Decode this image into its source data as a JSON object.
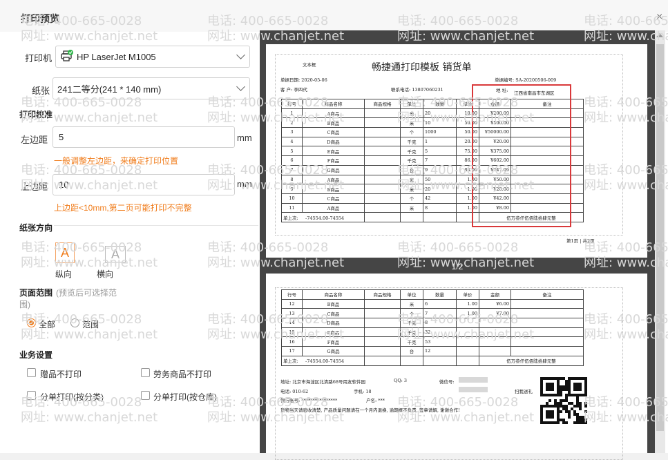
{
  "dialog": {
    "title": "打印预览",
    "close": "×"
  },
  "settings": {
    "printer_label": "打印机",
    "printer_value": "HP LaserJet M1005",
    "paper_label": "纸张",
    "paper_value": "241二等分(241 * 140 mm)",
    "calibration_title": "打印校准",
    "left_margin_label": "左边距",
    "left_margin_value": "5",
    "left_margin_unit": "mm",
    "left_hint": "一般调整左边距，来确定打印位置",
    "top_margin_label": "上边距",
    "top_margin_value": "10",
    "top_margin_unit": "mm",
    "top_hint": "上边距<10mm,第二页可能打印不完整",
    "orientation_title": "纸张方向",
    "portrait_glyph": "A",
    "portrait_label": "纵向",
    "landscape_glyph": "A",
    "landscape_label": "横向",
    "range_title": "页面范围",
    "range_note": "(预览后可选择范",
    "range_note2": "围)",
    "range_all": "全部",
    "range_custom": "范围",
    "business_title": "业务设置",
    "opt1": "赠品不打印",
    "opt2": "劳务商品不打印",
    "opt3": "分单打印(按分类)",
    "opt4": "分单打印(按仓库)"
  },
  "watermark": {
    "phone": "电话: 400-665-0028",
    "site": "网址: www.chanjet.net"
  },
  "preview": {
    "page_indicator": "1/2",
    "doc_label": "文本框",
    "doc_title": "畅捷通打印模板 销货单",
    "date": "单据日期: 2020-05-06",
    "doc_no": "单据编号: SA-20200506-009",
    "customer": "客    户: 李四代",
    "contact": "联系电话: 13807060231",
    "address": "地  址:",
    "address_value": "江西省南昌市东湖区",
    "headers": [
      "行号",
      "商品名称",
      "商品规格",
      "单位",
      "数量",
      "单价",
      "金额",
      "备注"
    ],
    "rows1": [
      [
        "1",
        "A商品",
        "",
        "米",
        "20",
        "10.00",
        "¥200.00",
        ""
      ],
      [
        "2",
        "B商品",
        "",
        "米",
        "10",
        "50.00",
        "¥500.00",
        ""
      ],
      [
        "3",
        "C商品",
        "",
        "个",
        "1000",
        "50.00",
        "¥50000.00",
        ""
      ],
      [
        "4",
        "D商品",
        "",
        "千克",
        "1",
        "20.00",
        "¥20.00",
        ""
      ],
      [
        "5",
        "E商品",
        "",
        "千克",
        "5",
        "75.00",
        "¥375.00",
        ""
      ],
      [
        "6",
        "F商品",
        "",
        "千克",
        "7",
        "86.00",
        "¥602.00",
        ""
      ],
      [
        "7",
        "G商品",
        "",
        "台",
        "9",
        "83.00",
        "¥747.00",
        ""
      ],
      [
        "8",
        "A商品",
        "",
        "米",
        "50",
        "1.00",
        "¥50.00",
        ""
      ],
      [
        "9",
        "B商品",
        "",
        "米",
        "20",
        "1.00",
        "¥20.00",
        ""
      ],
      [
        "10",
        "C商品",
        "",
        "个",
        "42",
        "1.00",
        "¥42.00",
        ""
      ],
      [
        "11",
        "A商品",
        "",
        "米",
        "8",
        "1.00",
        "¥8.00",
        ""
      ]
    ],
    "rows2": [
      [
        "12",
        "B商品",
        "",
        "米",
        "6",
        "1.00",
        "¥6.00",
        ""
      ],
      [
        "13",
        "C商品",
        "",
        "个",
        "7",
        "1.00",
        "¥7.00",
        ""
      ],
      [
        "14",
        "D商品",
        "",
        "千克",
        "8",
        "",
        "",
        ""
      ],
      [
        "15",
        "E商品",
        "",
        "千克",
        "32",
        "",
        "",
        ""
      ],
      [
        "16",
        "F商品",
        "",
        "千克",
        "53",
        "",
        "",
        ""
      ],
      [
        "17",
        "G商品",
        "",
        "台",
        "12",
        "",
        "",
        ""
      ]
    ],
    "total_label": "单上次:",
    "total_value": "-74554.00-74554",
    "total_words": "伍万叁仟伍佰陆拾肆元整",
    "page_footer": "第1页 | 共2页",
    "footer_address": "地址: 北京市海淀区北清路68号用友软件园",
    "footer_qq": "QQ: 3",
    "footer_wechat": "微信号:",
    "footer_phone": "电话: 010-62",
    "footer_mobile": "手机: 18",
    "footer_bank": "银行账号: ****************",
    "footer_account": "户名: ***",
    "footer_note": "货物当天请验收清楚, 产品质量问题请在一个月内退换, 逾期概不负责, 签章请解, 谢谢合作!",
    "footer_scan": "扫我送礼"
  },
  "colors": {
    "accent": "#f07c1b",
    "highlight": "#d9383a",
    "preview_bg": "#454545"
  }
}
